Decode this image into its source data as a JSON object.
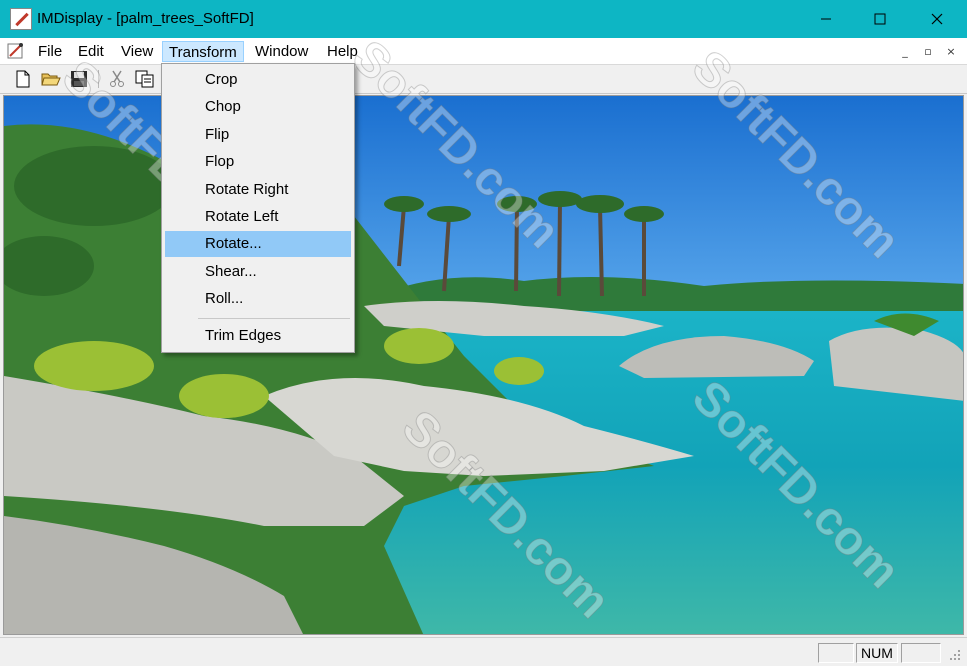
{
  "window": {
    "title": "IMDisplay - [palm_trees_SoftFD]",
    "controls": [
      "minimize",
      "maximize",
      "close"
    ]
  },
  "menubar": {
    "items": [
      "File",
      "Edit",
      "View",
      "Transform",
      "Window",
      "Help"
    ],
    "active": "Transform",
    "mdi_controls": [
      "_",
      "▫",
      "×"
    ]
  },
  "toolbar": {
    "buttons": [
      "new-file-icon",
      "open-folder-icon",
      "save-icon",
      "cut-icon",
      "copy-icon"
    ]
  },
  "transform_menu": {
    "items": [
      {
        "label": "Crop"
      },
      {
        "label": "Chop"
      },
      {
        "label": "Flip"
      },
      {
        "label": "Flop"
      },
      {
        "label": "Rotate Right"
      },
      {
        "label": "Rotate Left"
      },
      {
        "label": "Rotate...",
        "highlighted": true
      },
      {
        "label": "Shear..."
      },
      {
        "label": "Roll..."
      },
      {
        "label": "Trim Edges"
      }
    ]
  },
  "statusbar": {
    "num": "NUM"
  },
  "watermark": "SoftFD.com",
  "colors": {
    "titlebar": "#0db6c4",
    "menu_highlight": "#91c9f7",
    "active_menu": "#cce8ff"
  }
}
